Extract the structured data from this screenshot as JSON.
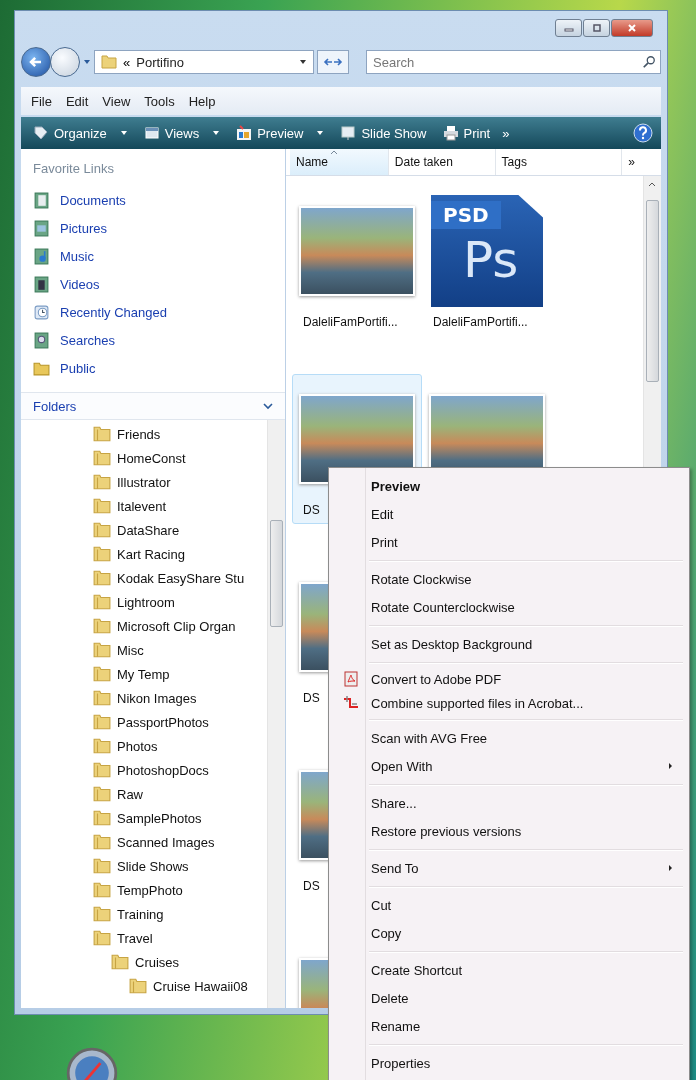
{
  "address_bar": {
    "overflow": "«",
    "location": "Portifino"
  },
  "search": {
    "placeholder": "Search"
  },
  "menu_bar": [
    "File",
    "Edit",
    "View",
    "Tools",
    "Help"
  ],
  "toolbar": {
    "items": [
      {
        "label": "Organize",
        "kind": "organize",
        "dropdown": true
      },
      {
        "label": "Views",
        "kind": "views",
        "dropdown": true
      },
      {
        "label": "Preview",
        "kind": "preview",
        "dropdown": true
      },
      {
        "label": "Slide Show",
        "kind": "slideshow",
        "dropdown": false
      },
      {
        "label": "Print",
        "kind": "print",
        "dropdown": false
      }
    ],
    "more": "»"
  },
  "favorite_links": {
    "title": "Favorite Links",
    "items": [
      {
        "label": "Documents",
        "kind": "documents"
      },
      {
        "label": "Pictures",
        "kind": "pictures"
      },
      {
        "label": "Music",
        "kind": "music"
      },
      {
        "label": "Videos",
        "kind": "videos"
      },
      {
        "label": "Recently Changed",
        "kind": "recent"
      },
      {
        "label": "Searches",
        "kind": "searches"
      },
      {
        "label": "Public",
        "kind": "folder"
      }
    ]
  },
  "folders": {
    "title": "Folders",
    "expanded": true,
    "tree": [
      {
        "label": "Friends"
      },
      {
        "label": "HomeConst"
      },
      {
        "label": "Illustrator"
      },
      {
        "label": "Italevent"
      },
      {
        "label": "DataShare"
      },
      {
        "label": "Kart Racing"
      },
      {
        "label": "Kodak EasyShare Stu"
      },
      {
        "label": "Lightroom"
      },
      {
        "label": "Microsoft Clip Organ"
      },
      {
        "label": "Misc"
      },
      {
        "label": "My Temp"
      },
      {
        "label": "Nikon Images"
      },
      {
        "label": "PassportPhotos"
      },
      {
        "label": "Photos"
      },
      {
        "label": "PhotoshopDocs"
      },
      {
        "label": "Raw"
      },
      {
        "label": "SamplePhotos"
      },
      {
        "label": "Scanned Images"
      },
      {
        "label": "Slide Shows"
      },
      {
        "label": "TempPhoto"
      },
      {
        "label": "Training"
      },
      {
        "label": "Travel",
        "children": [
          {
            "label": "Cruises",
            "children": [
              {
                "label": "Cruise Hawaii08"
              }
            ]
          }
        ]
      }
    ]
  },
  "columns": [
    {
      "label": "Name",
      "sorted": true
    },
    {
      "label": "Date taken",
      "sorted": false
    },
    {
      "label": "Tags",
      "sorted": false
    }
  ],
  "columns_more": "»",
  "file_rows": [
    [
      {
        "name": "DaleliFamPortifi...",
        "kind": "photo",
        "selected": false
      },
      {
        "name": "DaleliFamPortifi...",
        "kind": "psd",
        "selected": false,
        "icon_texts": [
          "PSD",
          "Ps"
        ]
      }
    ],
    [
      {
        "name": "DS",
        "kind": "photo",
        "selected": true
      },
      {
        "kind": "photo",
        "selected": false
      }
    ],
    [
      {
        "name": "DS",
        "kind": "photo",
        "selected": false
      }
    ],
    [
      {
        "name": "DS",
        "kind": "photo",
        "selected": false
      }
    ],
    [
      {
        "kind": "photo",
        "selected": false
      }
    ]
  ],
  "context_menu": {
    "groups": [
      [
        {
          "label": "Preview",
          "kind": "default"
        },
        {
          "label": "Edit",
          "kind": "plain"
        },
        {
          "label": "Print",
          "kind": "plain"
        }
      ],
      [
        {
          "label": "Rotate Clockwise",
          "kind": "plain"
        },
        {
          "label": "Rotate Counterclockwise",
          "kind": "plain"
        }
      ],
      [
        {
          "label": "Set as Desktop Background",
          "kind": "plain"
        }
      ],
      [
        {
          "label": "Convert to Adobe PDF",
          "kind": "pdf"
        },
        {
          "label": "Combine supported files in Acrobat...",
          "kind": "merge"
        }
      ],
      [
        {
          "label": "Scan with AVG Free",
          "kind": "plain"
        },
        {
          "label": "Open With",
          "kind": "submenu"
        }
      ],
      [
        {
          "label": "Share...",
          "kind": "plain"
        },
        {
          "label": "Restore previous versions",
          "kind": "plain"
        }
      ],
      [
        {
          "label": "Send To",
          "kind": "submenu"
        }
      ],
      [
        {
          "label": "Cut",
          "kind": "plain"
        },
        {
          "label": "Copy",
          "kind": "plain"
        }
      ],
      [
        {
          "label": "Create Shortcut",
          "kind": "plain"
        },
        {
          "label": "Delete",
          "kind": "plain"
        },
        {
          "label": "Rename",
          "kind": "plain"
        }
      ],
      [
        {
          "label": "Properties",
          "kind": "plain"
        }
      ]
    ]
  }
}
